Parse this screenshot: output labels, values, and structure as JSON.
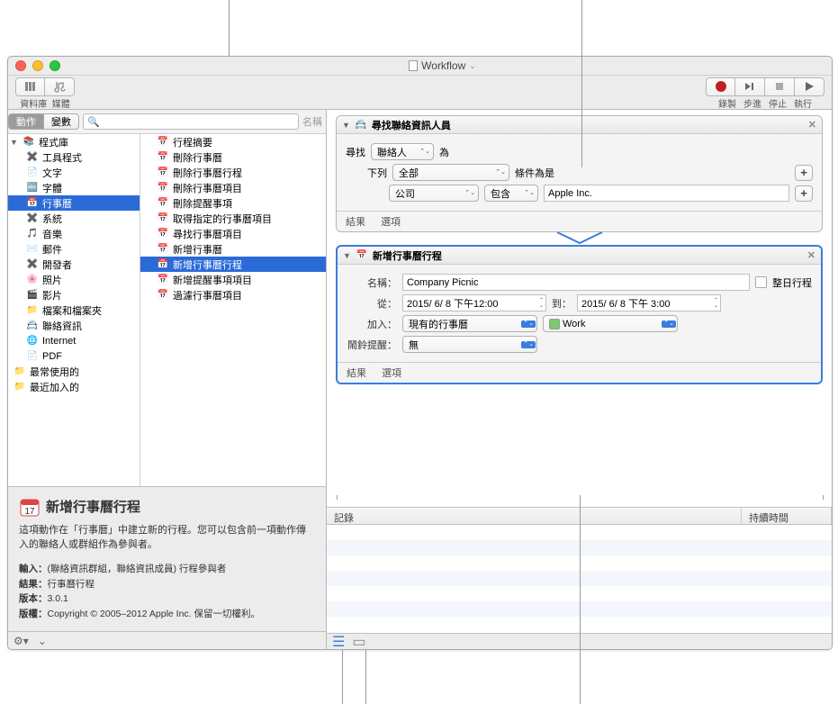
{
  "title": "Workflow",
  "toolbar": {
    "library": "資料庫",
    "media": "媒體",
    "record": "錄製",
    "step": "步進",
    "stop": "停止",
    "run": "執行"
  },
  "sidebar": {
    "tabs": {
      "actions": "動作",
      "variables": "變數"
    },
    "search_placeholder": "",
    "name_label": "名稱",
    "root": "程式庫",
    "categories": [
      "工具程式",
      "文字",
      "字體",
      "行事曆",
      "系統",
      "音樂",
      "郵件",
      "開發者",
      "照片",
      "影片",
      "檔案和檔案夾",
      "聯絡資訊",
      "Internet",
      "PDF"
    ],
    "recent": "最常使用的",
    "recently_added": "最近加入的",
    "selected_category_index": 3,
    "actions": [
      "行程摘要",
      "刪除行事曆",
      "刪除行事曆行程",
      "刪除行事曆項目",
      "刪除提醒事項",
      "取得指定的行事曆項目",
      "尋找行事曆項目",
      "新增行事曆",
      "新增行事曆行程",
      "新增提醒事項項目",
      "過濾行事曆項目"
    ],
    "selected_action_index": 8
  },
  "info": {
    "title": "新增行事曆行程",
    "desc": "這項動作在「行事曆」中建立新的行程。您可以包含前一項動作傳入的聯絡人或群組作為參與者。",
    "input_label": "輸入：",
    "input": "(聯絡資訊群組，聯絡資訊成員) 行程參與者",
    "result_label": "結果：",
    "result": "行事曆行程",
    "version_label": "版本：",
    "version": "3.0.1",
    "copyright_label": "版權：",
    "copyright": "Copyright © 2005–2012 Apple Inc. 保留一切權利。"
  },
  "action1": {
    "title": "尋找聯絡資訊人員",
    "find_label": "尋找",
    "find_target": "聯絡人",
    "wei": "為",
    "where_label": "下列",
    "scope": "全部",
    "cond_label": "條件為是",
    "field": "公司",
    "op": "包含",
    "value": "Apple Inc.",
    "results": "結果",
    "options": "選項"
  },
  "action2": {
    "title": "新增行事曆行程",
    "name_label": "名稱：",
    "name_value": "Company Picnic",
    "allday": "整日行程",
    "from_label": "從：",
    "from_value": "2015/ 6/ 8 下午12:00",
    "to_label": "到：",
    "to_value": "2015/ 6/ 8 下午 3:00",
    "addto_label": "加入：",
    "addto_value": "現有的行事曆",
    "calendar": "Work",
    "alarm_label": "鬧鈴提醒：",
    "alarm_value": "無",
    "results": "結果",
    "options": "選項"
  },
  "log": {
    "record": "記錄",
    "duration": "持續時間"
  }
}
